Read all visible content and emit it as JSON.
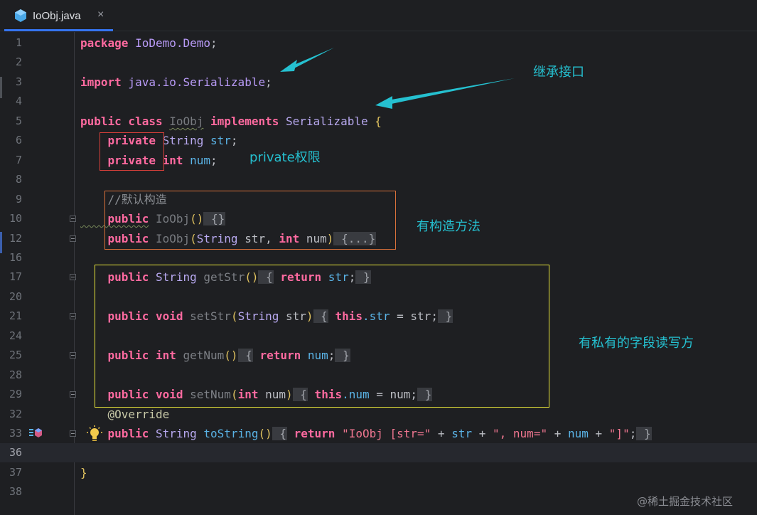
{
  "tab": {
    "filename": "IoObj.java",
    "close_glyph": "×"
  },
  "editor": {
    "current_line": "36",
    "lines": [
      {
        "no": "1",
        "code": [
          [
            "kw",
            "package"
          ],
          [
            "",
            ""
          ],
          [
            "pkg",
            " IoDemo.Demo"
          ],
          [
            "",
            ";"
          ]
        ]
      },
      {
        "no": "2",
        "code": []
      },
      {
        "no": "3",
        "code": [
          [
            "kw",
            "import"
          ],
          [
            "",
            ""
          ],
          [
            "pkg",
            " java.io.Serializable"
          ],
          [
            "",
            ";"
          ]
        ]
      },
      {
        "no": "4",
        "code": []
      },
      {
        "no": "5",
        "code": [
          [
            "kw",
            "public class "
          ],
          [
            "cls sq",
            "IoObj"
          ],
          [
            "kw",
            " implements "
          ],
          [
            "typ",
            "Serializable"
          ],
          [
            "brk",
            " {"
          ]
        ]
      },
      {
        "no": "6",
        "code": [
          [
            "",
            ""
          ],
          [
            "kw",
            "    private "
          ],
          [
            "typ",
            "String"
          ],
          [
            "fld",
            " str"
          ],
          [
            "",
            ";"
          ]
        ]
      },
      {
        "no": "7",
        "code": [
          [
            "",
            ""
          ],
          [
            "kw",
            "    private "
          ],
          [
            "kw",
            "int"
          ],
          [
            "fld",
            " num"
          ],
          [
            "",
            ";"
          ]
        ]
      },
      {
        "no": "8",
        "code": []
      },
      {
        "no": "9",
        "code": [
          [
            "cmt",
            "    //默认构造"
          ]
        ]
      },
      {
        "no": "10",
        "code": [
          [
            "kw sq",
            "    public"
          ],
          [
            "cls",
            " IoObj"
          ],
          [
            "brk",
            "()"
          ],
          [
            "",
            ""
          ],
          [
            "fb",
            " {}"
          ]
        ]
      },
      {
        "no": "12",
        "code": [
          [
            "kw",
            "    public"
          ],
          [
            "cls",
            " IoObj"
          ],
          [
            "brk",
            "("
          ],
          [
            "typ",
            "String"
          ],
          [
            "",
            " str, "
          ],
          [
            "kw",
            "int"
          ],
          [
            "",
            " num"
          ],
          [
            "brk",
            ")"
          ],
          [
            "fb",
            " {...}"
          ]
        ]
      },
      {
        "no": "16",
        "code": []
      },
      {
        "no": "17",
        "code": [
          [
            "kw",
            "    public "
          ],
          [
            "typ",
            "String"
          ],
          [
            "mth",
            " getStr"
          ],
          [
            "brk",
            "()"
          ],
          [
            "fb",
            " {"
          ],
          [
            "kw",
            " return"
          ],
          [
            "fld",
            " str"
          ],
          [
            "",
            ";"
          ],
          [
            "fb",
            " }"
          ]
        ]
      },
      {
        "no": "20",
        "code": []
      },
      {
        "no": "21",
        "code": [
          [
            "kw",
            "    public void"
          ],
          [
            "mth",
            " setStr"
          ],
          [
            "brk",
            "("
          ],
          [
            "typ",
            "String"
          ],
          [
            "",
            " str"
          ],
          [
            "brk",
            ")"
          ],
          [
            "fb",
            " {"
          ],
          [
            "kw",
            " this"
          ],
          [
            "",
            ""
          ],
          [
            "fld",
            ".str"
          ],
          [
            "",
            " = str;"
          ],
          [
            "fb",
            " }"
          ]
        ]
      },
      {
        "no": "24",
        "code": []
      },
      {
        "no": "25",
        "code": [
          [
            "kw",
            "    public int"
          ],
          [
            "mth",
            " getNum"
          ],
          [
            "brk",
            "()"
          ],
          [
            "fb",
            " {"
          ],
          [
            "kw",
            " return"
          ],
          [
            "fld",
            " num"
          ],
          [
            "",
            ";"
          ],
          [
            "fb",
            " }"
          ]
        ]
      },
      {
        "no": "28",
        "code": []
      },
      {
        "no": "29",
        "code": [
          [
            "kw",
            "    public void"
          ],
          [
            "mth",
            " setNum"
          ],
          [
            "brk",
            "("
          ],
          [
            "kw",
            "int"
          ],
          [
            "",
            " num"
          ],
          [
            "brk",
            ")"
          ],
          [
            "fb",
            " {"
          ],
          [
            "kw",
            " this"
          ],
          [
            "fld",
            ".num"
          ],
          [
            "",
            " = num;"
          ],
          [
            "fb",
            " }"
          ]
        ]
      },
      {
        "no": "32",
        "code": [
          [
            "ann",
            "    @Override"
          ]
        ]
      },
      {
        "no": "33",
        "code": [
          [
            "kw",
            "    public "
          ],
          [
            "typ",
            "String"
          ],
          [
            "fld",
            " toString"
          ],
          [
            "brk",
            "()"
          ],
          [
            "fb",
            " {"
          ],
          [
            "kw",
            " return"
          ],
          [
            "str",
            " \"IoObj [str=\""
          ],
          [
            "",
            " + "
          ],
          [
            "fld",
            "str"
          ],
          [
            "",
            " + "
          ],
          [
            "str",
            "\", num=\""
          ],
          [
            "",
            " + "
          ],
          [
            "fld",
            "num"
          ],
          [
            "",
            " + "
          ],
          [
            "str",
            "\"]\""
          ],
          [
            "",
            ";"
          ],
          [
            "fb",
            " }"
          ]
        ]
      },
      {
        "no": "36",
        "code": []
      },
      {
        "no": "37",
        "code": [
          [
            "brk",
            "}"
          ]
        ]
      },
      {
        "no": "38",
        "code": []
      }
    ]
  },
  "annotations": {
    "inherit_interface": "继承接口",
    "private_scope": "private权限",
    "constructors": "有构造方法",
    "accessors": "有私有的字段读写方",
    "watermark": "@稀土掘金技术社区"
  },
  "colors": {
    "annotation_text": "#25c0d0",
    "private_box": "#d9403a",
    "constructor_box": "#d9703a",
    "accessor_box": "#e8e53a",
    "arrow": "#25c0d0"
  },
  "icons": [
    "java-class-icon",
    "close-icon",
    "fold-icon",
    "implements-icon",
    "lightbulb-icon"
  ]
}
